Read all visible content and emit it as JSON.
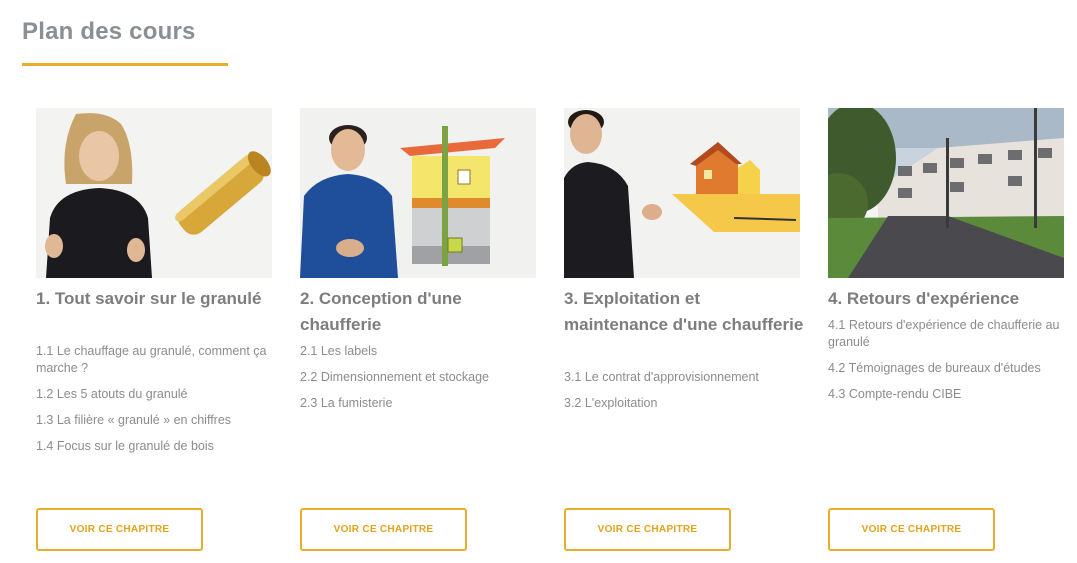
{
  "page": {
    "title": "Plan des cours",
    "accent_color": "#e8ad2b"
  },
  "chapters": [
    {
      "title": "1. Tout savoir sur le granulé",
      "thumbnail": "presenter-woman-with-pellet",
      "lessons": [
        "1.1 Le chauffage au granulé, comment ça marche ?",
        "1.2 Les 5 atouts du granulé",
        "1.3 La filière « granulé » en chiffres",
        "1.4 Focus sur le granulé de bois"
      ],
      "button_label": "VOIR CE CHAPITRE"
    },
    {
      "title": "2. Conception d'une chaufferie",
      "thumbnail": "presenter-man-with-house-cutaway",
      "lessons": [
        "2.1 Les labels",
        "2.2 Dimensionnement et stockage",
        "2.3 La fumisterie"
      ],
      "button_label": "VOIR CE CHAPITRE"
    },
    {
      "title": "3. Exploitation et maintenance d'une chaufferie",
      "thumbnail": "presenter-man-with-house-delivery",
      "lessons": [
        "3.1 Le contrat d'approvisionnement",
        "3.2 L'exploitation"
      ],
      "button_label": "VOIR CE CHAPITRE"
    },
    {
      "title": "4. Retours d'expérience",
      "thumbnail": "residential-buildings-photo",
      "lessons": [
        "4.1 Retours d'expérience de chaufferie au granulé",
        "4.2 Témoignages de bureaux d'études",
        "4.3 Compte-rendu CIBE"
      ],
      "button_label": "VOIR CE CHAPITRE"
    }
  ]
}
